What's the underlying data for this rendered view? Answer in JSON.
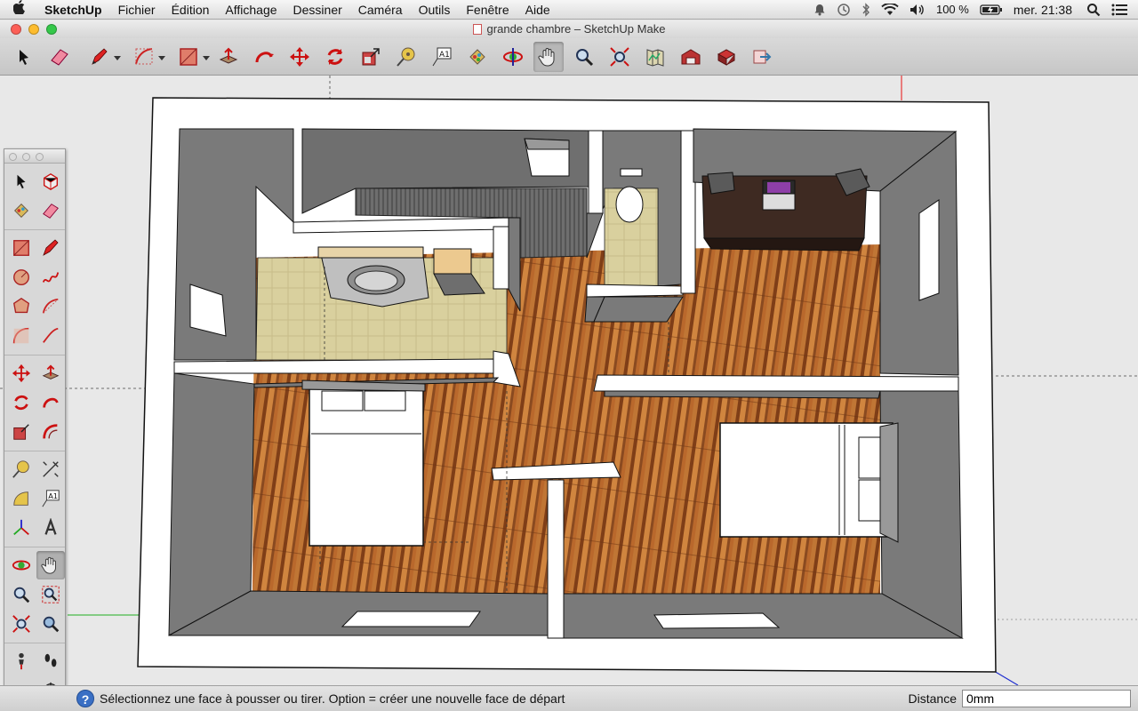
{
  "menubar": {
    "app": "SketchUp",
    "items": [
      "Fichier",
      "Édition",
      "Affichage",
      "Dessiner",
      "Caméra",
      "Outils",
      "Fenêtre",
      "Aide"
    ],
    "battery": "100 %",
    "clock": "mer. 21:38"
  },
  "window": {
    "title": "grande chambre – SketchUp Make"
  },
  "toolbar": {
    "tools": [
      "select-tool",
      "eraser-tool",
      "pencil-tool",
      "arc-tool",
      "rectangle-tool",
      "push-pull-tool",
      "follow-me-tool",
      "move-tool",
      "rotate-tool",
      "scale-tool",
      "tape-measure-tool",
      "text-tool",
      "paint-bucket-tool",
      "orbit-tool",
      "pan-tool",
      "zoom-tool",
      "zoom-extents-tool",
      "previous-view-tool",
      "3d-warehouse-tool",
      "components-tool",
      "share-model-tool"
    ],
    "pressed": "pan-tool"
  },
  "palette": {
    "pressed": "pan-tool"
  },
  "status": {
    "hint": "Sélectionnez une face à pousser ou tirer. Option = créer une nouvelle face de départ",
    "distance_label": "Distance",
    "distance_value": "0mm"
  },
  "colors": {
    "wall_gray": "#7a7a7a",
    "wood": "#a65a22",
    "tile": "#d8cfa0",
    "axis_red": "#e81010",
    "axis_green": "#1fae1f",
    "axis_blue": "#2030d0"
  }
}
